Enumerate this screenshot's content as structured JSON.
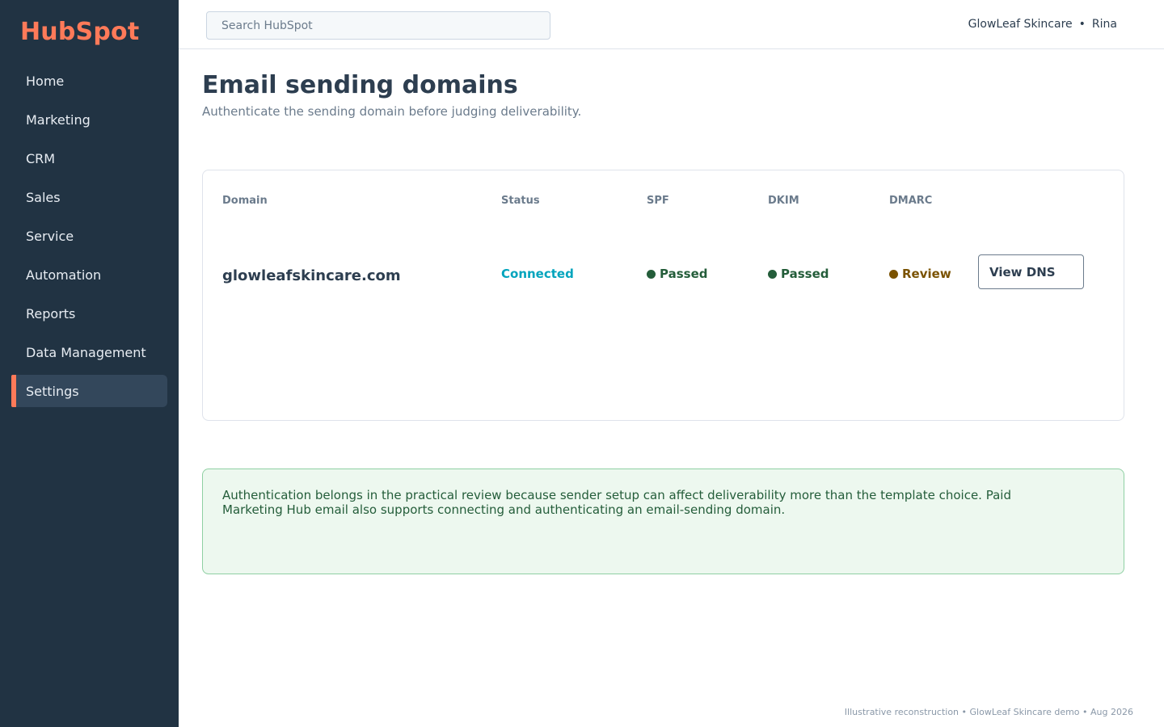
{
  "sidebar": {
    "logo": "HubSpot",
    "items": [
      {
        "label": "Home"
      },
      {
        "label": "Marketing"
      },
      {
        "label": "CRM"
      },
      {
        "label": "Sales"
      },
      {
        "label": "Service"
      },
      {
        "label": "Automation"
      },
      {
        "label": "Reports"
      },
      {
        "label": "Data Management"
      },
      {
        "label": "Settings",
        "active": true
      }
    ]
  },
  "topbar": {
    "search_placeholder": "Search HubSpot",
    "account_name": "GlowLeaf Skincare",
    "separator": "•",
    "user_name": "Rina"
  },
  "page": {
    "title": "Email sending domains",
    "subtitle": "Authenticate the sending domain before judging deliverability."
  },
  "table": {
    "columns": [
      "Domain",
      "Status",
      "SPF",
      "DKIM",
      "DMARC"
    ],
    "rows": [
      {
        "domain": "glowleafskincare.com",
        "status": "Connected",
        "spf": "Passed",
        "dkim": "Passed",
        "dmarc": "Review",
        "action": "View DNS"
      }
    ]
  },
  "note": {
    "text": "Authentication belongs in the practical review because sender setup can affect deliverability more than the template choice. Paid Marketing Hub email also supports connecting and authenticating an email-sending domain."
  },
  "footer": {
    "text": "Illustrative reconstruction • GlowLeaf Skincare demo • Aug 2026"
  },
  "colors": {
    "sidebar_bg": "#213343",
    "accent": "#ff7a59",
    "connected": "#00a4bd",
    "passed": "#245d3a",
    "review": "#7a5200",
    "note_bg": "#edf8ef"
  }
}
